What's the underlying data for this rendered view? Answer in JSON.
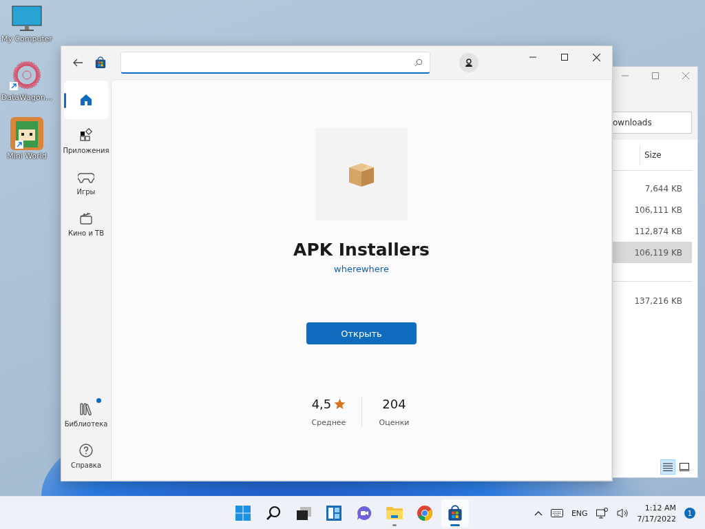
{
  "desktop_icons": [
    {
      "kind": "computer",
      "label": "My Computer",
      "shortcut": false
    },
    {
      "kind": "star",
      "label": "DataWagon...",
      "shortcut": true
    },
    {
      "kind": "game",
      "label": "Mini World",
      "shortcut": true
    }
  ],
  "explorer": {
    "search_value": "ownloads",
    "column": "Size",
    "rows": [
      {
        "size": "7,644 KB",
        "selected": false
      },
      {
        "size": "106,111 KB",
        "selected": false
      },
      {
        "size": "112,874 KB",
        "selected": false
      },
      {
        "size": "106,119 KB",
        "selected": true
      },
      {
        "size": "137,216 KB",
        "selected": false
      }
    ],
    "views": [
      {
        "kind": "details",
        "selected": true
      },
      {
        "kind": "preview",
        "selected": false
      }
    ]
  },
  "store": {
    "nav": [
      {
        "kind": "home",
        "selected": true,
        "badge": false
      },
      {
        "kind": "apps",
        "label": "Приложения",
        "selected": false,
        "badge": false
      },
      {
        "kind": "games",
        "label": "Игры",
        "selected": false,
        "badge": false
      },
      {
        "kind": "movies",
        "label": "Кино и ТВ",
        "selected": false,
        "badge": false
      },
      {
        "kind": "library",
        "label": "Библиотека",
        "selected": false,
        "badge": true
      },
      {
        "kind": "help",
        "label": "Справка",
        "selected": false,
        "badge": false
      }
    ],
    "app": {
      "name": "APK Installers",
      "publisher": "wherewhere",
      "button": "Открыть",
      "rating": "4,5",
      "rating_label": "Среднее",
      "count": "204",
      "count_label": "Оценки"
    }
  },
  "taskbar": {
    "items": [
      {
        "kind": "start",
        "running": false,
        "selected": false
      },
      {
        "kind": "search",
        "running": false,
        "selected": false
      },
      {
        "kind": "taskview",
        "running": false,
        "selected": false
      },
      {
        "kind": "widgets",
        "running": false,
        "selected": false
      },
      {
        "kind": "chat",
        "running": false,
        "selected": false
      },
      {
        "kind": "explorer",
        "running": true,
        "selected": false
      },
      {
        "kind": "chrome",
        "running": false,
        "selected": false
      },
      {
        "kind": "store",
        "running": true,
        "selected": true
      }
    ],
    "language": "ENG",
    "time": "1:12 AM",
    "date": "7/17/2022",
    "notifications": "1"
  }
}
